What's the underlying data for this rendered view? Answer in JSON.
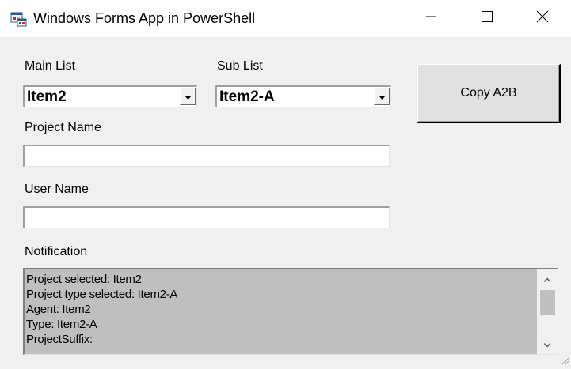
{
  "window": {
    "title": "Windows Forms App in PowerShell",
    "icon": "winforms-app-icon",
    "controls": [
      "minimize-icon",
      "maximize-icon",
      "close-icon"
    ]
  },
  "form": {
    "main_list": {
      "label": "Main List",
      "selected": "Item2"
    },
    "sub_list": {
      "label": "Sub List",
      "selected": "Item2-A"
    },
    "copy_button": {
      "label": "Copy A2B"
    },
    "project_name": {
      "label": "Project Name",
      "value": ""
    },
    "user_name": {
      "label": "User Name",
      "value": ""
    },
    "notification": {
      "label": "Notification",
      "lines": [
        "Project selected: Item2",
        "Project type selected: Item2-A",
        "Agent: Item2",
        "Type: Item2-A",
        "ProjectSuffix:"
      ]
    }
  },
  "colors": {
    "form_background": "#f0f0f0",
    "titlebar_background": "#ffffff",
    "notification_background": "#bfbfbf"
  }
}
